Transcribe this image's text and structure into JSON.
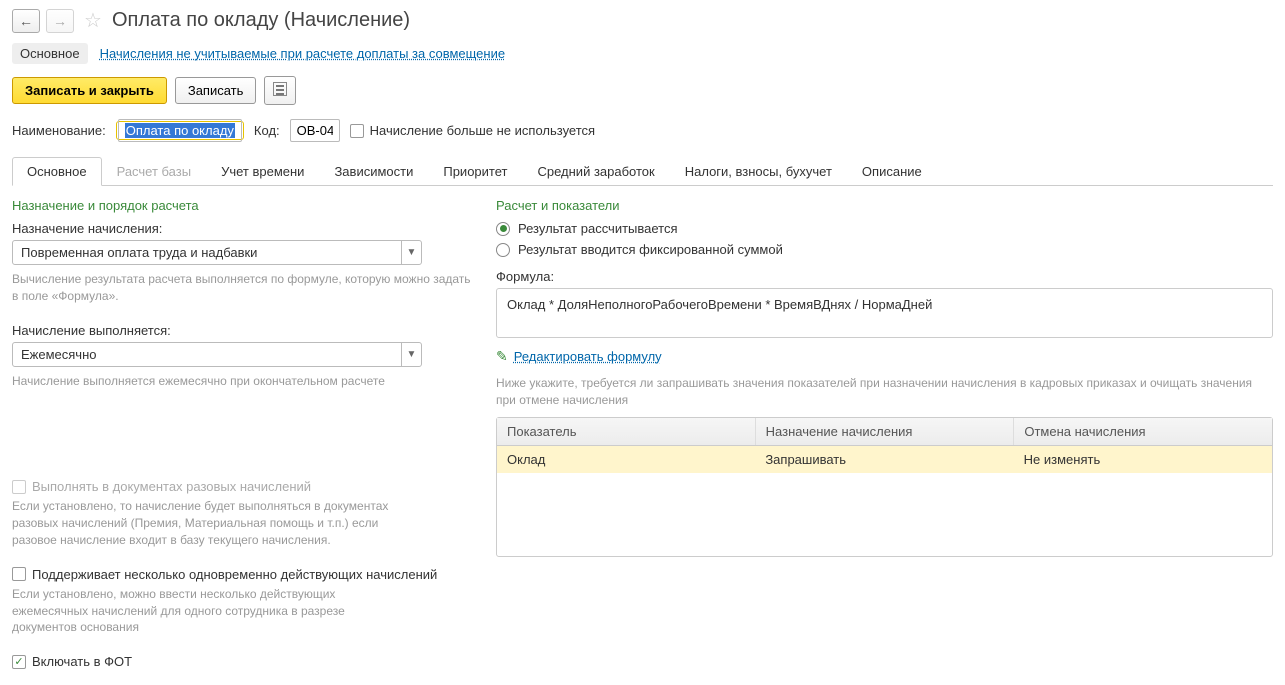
{
  "header": {
    "title": "Оплата по окладу (Начисление)"
  },
  "topTabs": {
    "main": "Основное",
    "link": "Начисления не учитываемые при расчете доплаты за совмещение"
  },
  "toolbar": {
    "saveClose": "Записать и закрыть",
    "save": "Записать"
  },
  "nameRow": {
    "nameLabel": "Наименование:",
    "nameValue": "Оплата по окладу",
    "codeLabel": "Код:",
    "codeValue": "ОВ-04",
    "unusedLabel": "Начисление больше не используется"
  },
  "tabs": [
    "Основное",
    "Расчет базы",
    "Учет времени",
    "Зависимости",
    "Приоритет",
    "Средний заработок",
    "Налоги, взносы, бухучет",
    "Описание"
  ],
  "left": {
    "sectionTitle": "Назначение и порядок расчета",
    "purposeLabel": "Назначение начисления:",
    "purposeValue": "Повременная оплата труда и надбавки",
    "purposeHint": "Вычисление результата расчета выполняется по формуле, которую можно задать в поле «Формула».",
    "execLabel": "Начисление выполняется:",
    "execValue": "Ежемесячно",
    "execHint": "Начисление выполняется ежемесячно при окончательном расчете",
    "oneTimeLabel": "Выполнять в документах разовых начислений",
    "oneTimeHint": "Если установлено, то начисление будет выполняться в документах разовых начислений (Премия, Материальная помощь и т.п.) если разовое начисление входит в базу текущего начисления.",
    "multiLabel": "Поддерживает несколько одновременно действующих начислений",
    "multiHint": "Если установлено, можно ввести несколько действующих ежемесячных начислений для одного сотрудника в разрезе документов основания",
    "fotLabel": "Включать в ФОТ"
  },
  "right": {
    "sectionTitle": "Расчет и показатели",
    "radio1": "Результат рассчитывается",
    "radio2": "Результат вводится фиксированной суммой",
    "formulaLabel": "Формула:",
    "formulaValue": "Оклад * ДоляНеполногоРабочегоВремени * ВремяВДнях / НормаДней",
    "editFormula": "Редактировать формулу",
    "tableHint": "Ниже укажите, требуется ли запрашивать значения показателей при назначении начисления в кадровых приказах и очищать значения при отмене начисления",
    "cols": [
      "Показатель",
      "Назначение начисления",
      "Отмена начисления"
    ],
    "row": [
      "Оклад",
      "Запрашивать",
      "Не изменять"
    ]
  }
}
